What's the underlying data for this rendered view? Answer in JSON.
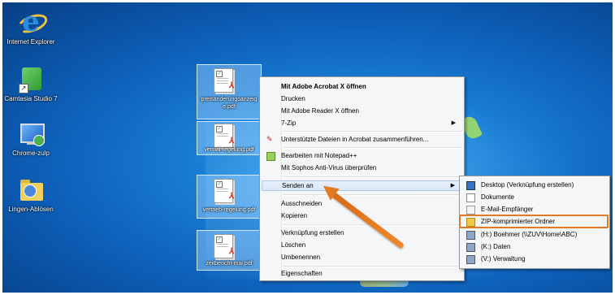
{
  "desktop_icons": [
    {
      "label": "Internet Explorer",
      "icon": "internet-explorer-icon"
    },
    {
      "label": "Camtasia Studio 7",
      "icon": "camtasia-icon"
    },
    {
      "label": "Chrome-zulp",
      "icon": "monitor-refresh-icon"
    },
    {
      "label": "Lingen-Ablösen",
      "icon": "folder-users-icon"
    }
  ],
  "selected_files": [
    {
      "label": "preisänderungsanzeige.pdf",
      "icon": "pdf-document-icon"
    },
    {
      "label": "verwal-regelung.pdf",
      "icon": "pdf-document-icon"
    },
    {
      "label": "vertrieb-regelung.pdf",
      "icon": "pdf-document-icon"
    },
    {
      "label": "zeitbericht-mai.pdf",
      "icon": "pdf-document-icon"
    }
  ],
  "context_menu": {
    "items": [
      {
        "label": "Mit Adobe Acrobat X öffnen",
        "bold": true
      },
      {
        "label": "Drucken"
      },
      {
        "label": "Mit Adobe Reader X öffnen"
      },
      {
        "label": "7-Zip",
        "submenu": true
      },
      {
        "label": "Unterstützte Dateien in Acrobat zusammenführen...",
        "icon": "acrobat-icon"
      },
      {
        "label": "Bearbeiten mit Notepad++",
        "icon": "notepad-icon"
      },
      {
        "label": "Mit Sophos Anti-Virus überprüfen"
      },
      {
        "label": "Senden an",
        "submenu": true,
        "highlighted": true
      },
      {
        "label": "Ausschneiden"
      },
      {
        "label": "Kopieren"
      },
      {
        "label": "Verknüpfung erstellen"
      },
      {
        "label": "Löschen"
      },
      {
        "label": "Umbenennen"
      },
      {
        "label": "Eigenschaften"
      }
    ]
  },
  "send_to_menu": {
    "items": [
      {
        "label": "Desktop (Verknüpfung erstellen)",
        "icon": "desktop-icon"
      },
      {
        "label": "Dokumente",
        "icon": "documents-icon"
      },
      {
        "label": "E-Mail-Empfänger",
        "icon": "mail-icon"
      },
      {
        "label": "ZIP-komprimierter Ordner",
        "icon": "zip-folder-icon",
        "emphasized": true
      },
      {
        "label": "(H:) Boehmer (\\\\ZUV\\Home\\ABC)",
        "icon": "network-drive-icon"
      },
      {
        "label": "(K:) Daten",
        "icon": "network-drive-icon"
      },
      {
        "label": "(V:) Verwaltung",
        "icon": "network-drive-icon"
      }
    ]
  },
  "colors": {
    "highlight_box": "#e07a24",
    "arrow": "#e47a20",
    "desktop_bg": "#1a7fd6"
  }
}
